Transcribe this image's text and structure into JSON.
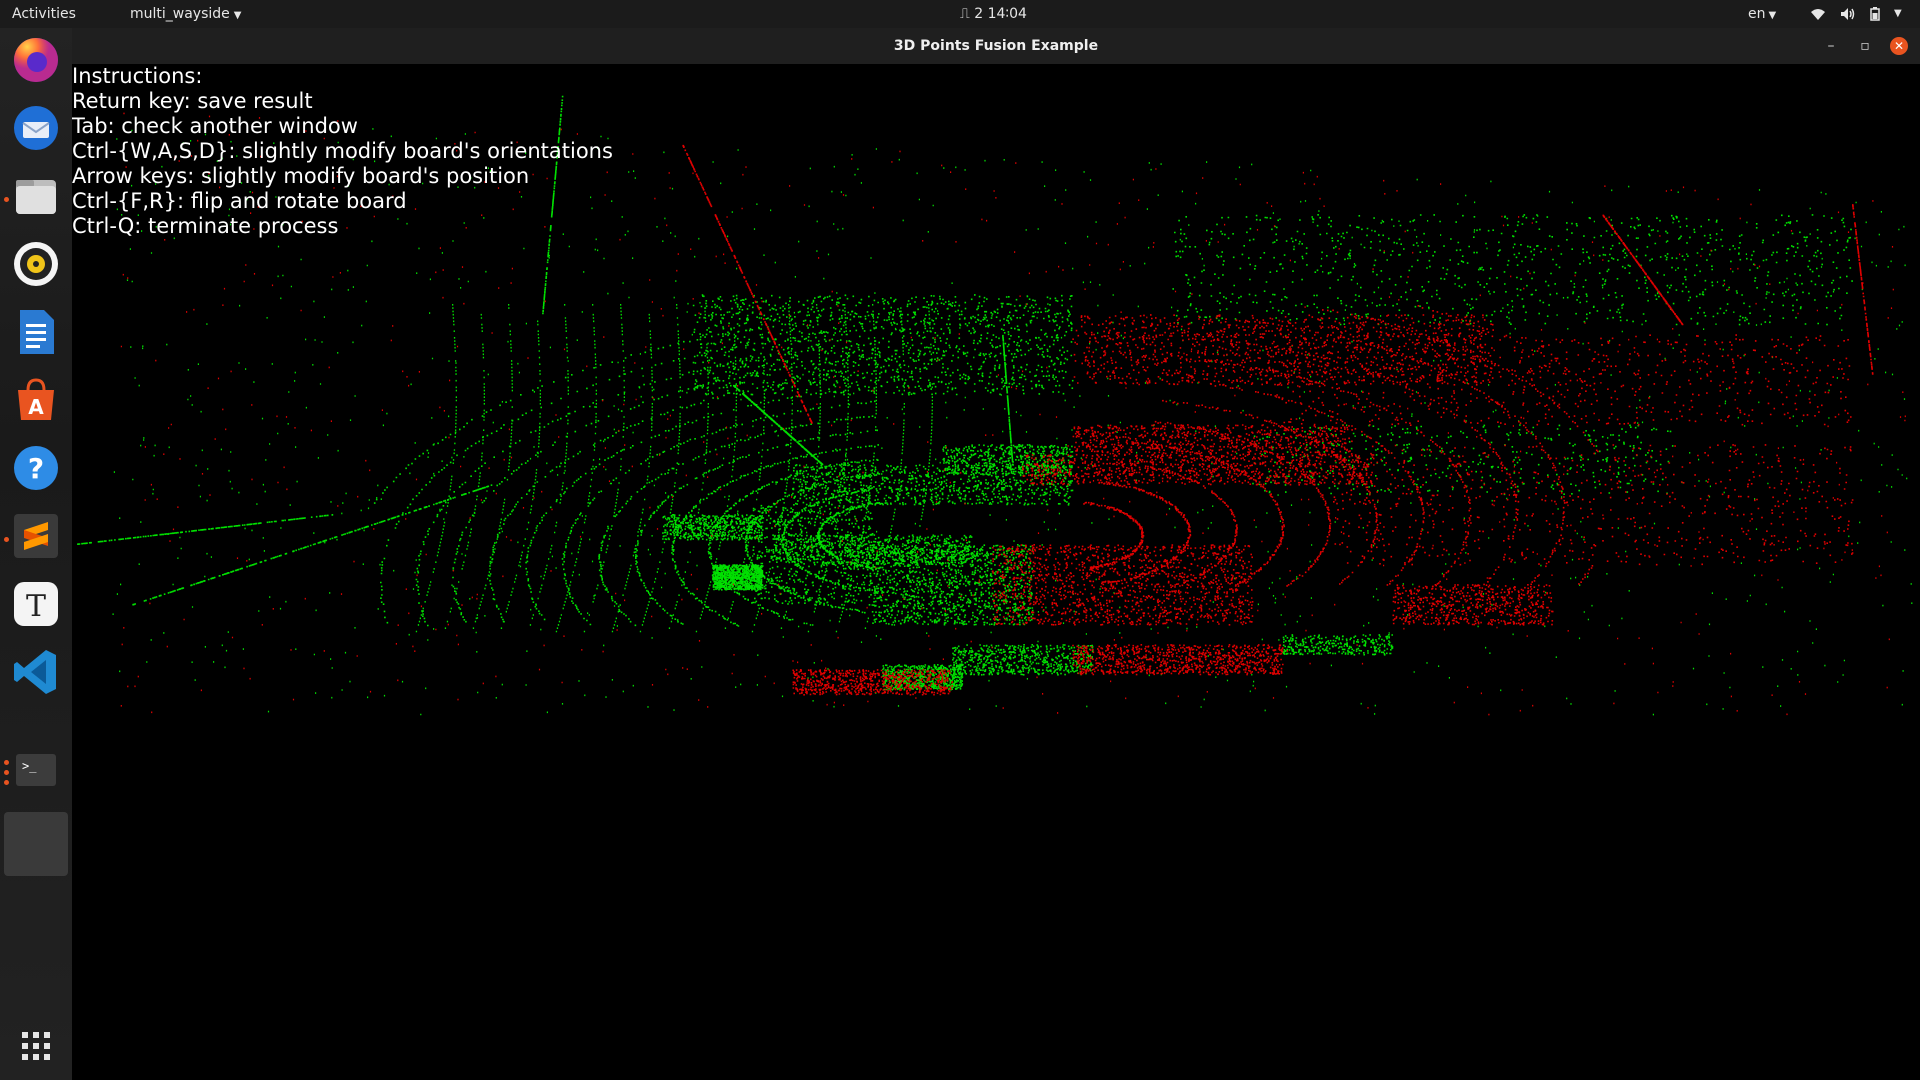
{
  "topbar": {
    "activities": "Activities",
    "app_menu": "multi_wayside",
    "clock": "⎍ 2  14∶04",
    "language": "en"
  },
  "window": {
    "title": "3D Points Fusion Example"
  },
  "instructions": {
    "lines": [
      "Instructions:",
      "Return key: save result",
      "Tab: check another window",
      "Ctrl-{W,A,S,D}: slightly modify board's orientations",
      "Arrow keys: slightly modify board's position",
      "Ctrl-{F,R}: flip and rotate board",
      "Ctrl-Q: terminate process"
    ]
  },
  "dock": {
    "items": [
      {
        "name": "firefox-icon"
      },
      {
        "name": "thunderbird-icon"
      },
      {
        "name": "files-icon"
      },
      {
        "name": "rhythmbox-icon"
      },
      {
        "name": "libreoffice-writer-icon"
      },
      {
        "name": "software-center-icon"
      },
      {
        "name": "help-icon"
      },
      {
        "name": "sublime-text-icon"
      },
      {
        "name": "typora-icon"
      },
      {
        "name": "vscode-icon"
      },
      {
        "name": "terminal-icon"
      },
      {
        "name": "active-window-icon"
      }
    ],
    "apps_grid": "show-applications-icon"
  },
  "colors": {
    "point_cloud_a": "#00e000",
    "point_cloud_b": "#e00000",
    "accent": "#e95420"
  }
}
